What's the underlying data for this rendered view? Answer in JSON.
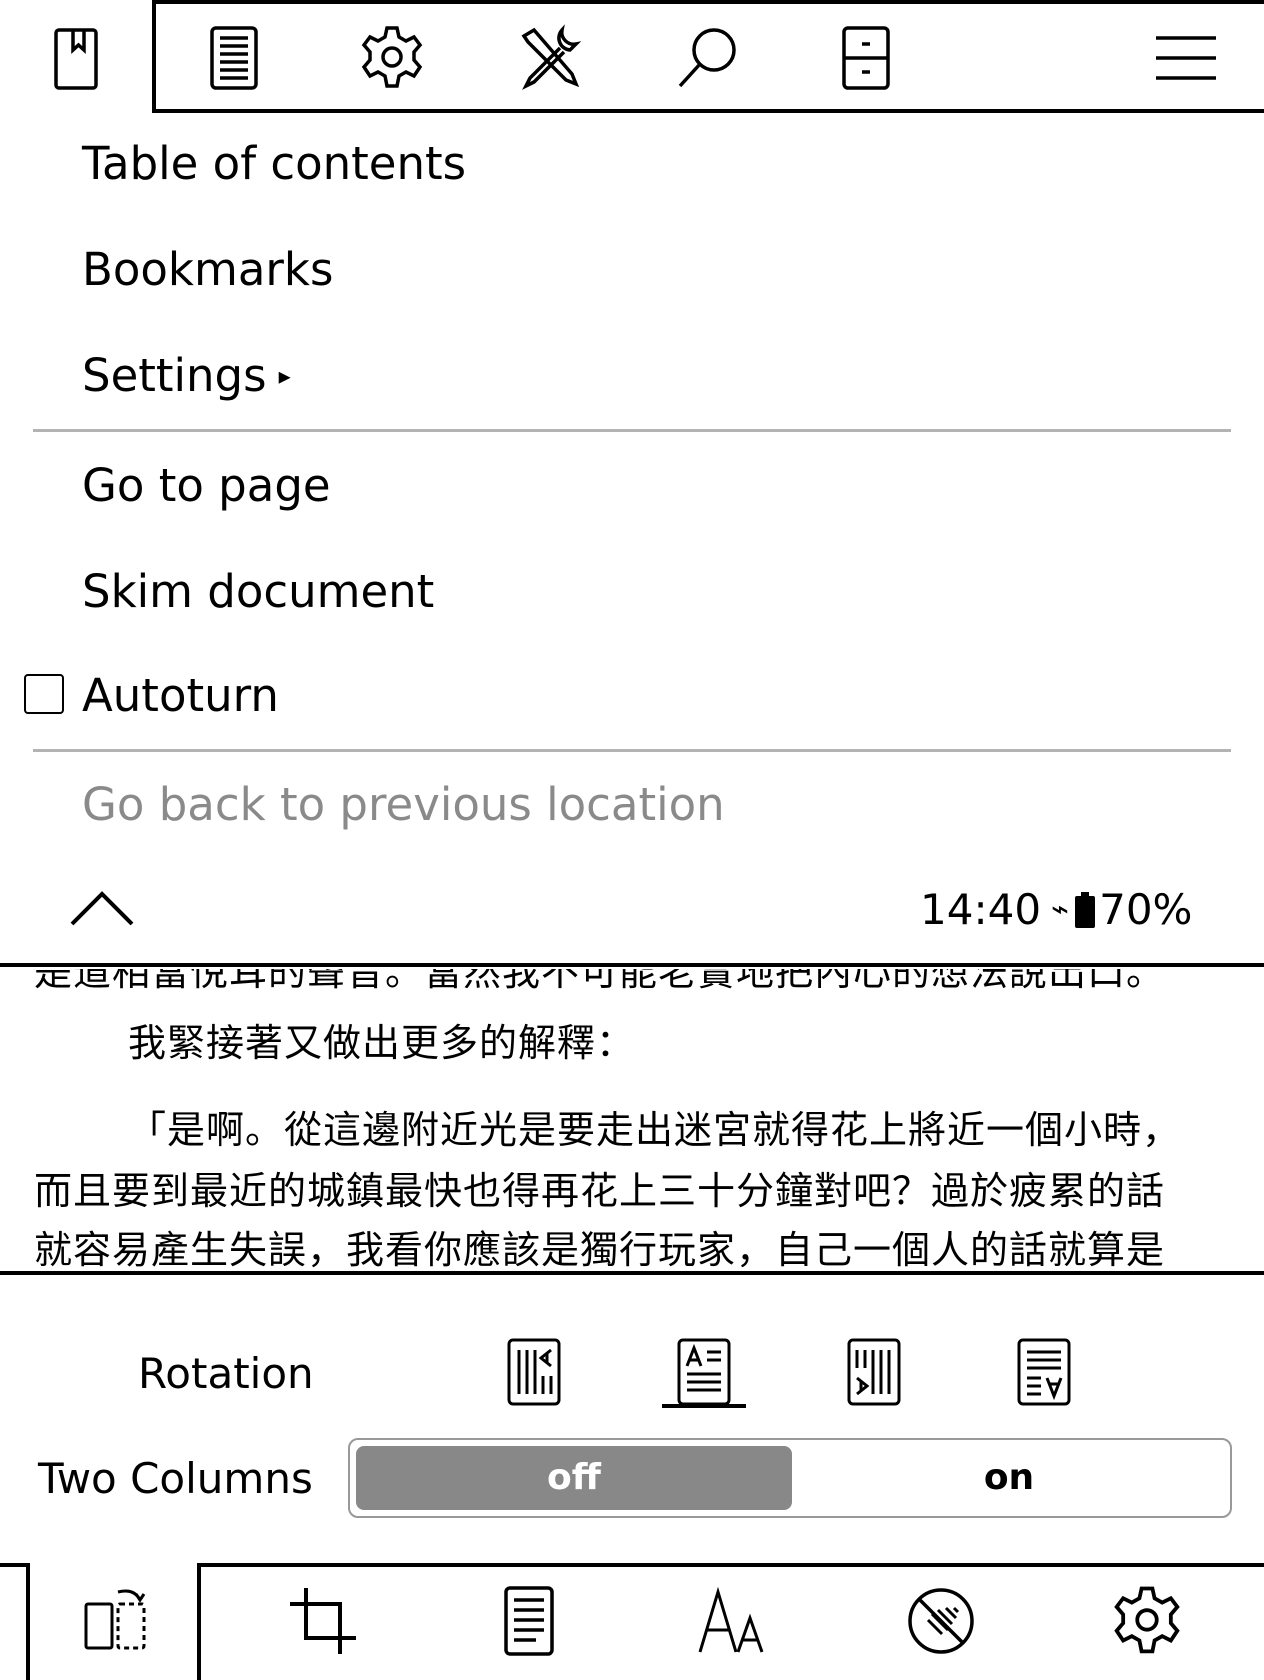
{
  "top_tabs": [
    {
      "icon": "bookmark-book-icon"
    },
    {
      "icon": "document-icon"
    },
    {
      "icon": "gear-icon"
    },
    {
      "icon": "tools-icon"
    },
    {
      "icon": "search-icon"
    },
    {
      "icon": "page-navigation-icon"
    },
    {
      "icon": "hamburger-menu-icon"
    }
  ],
  "menu": {
    "items": [
      {
        "label": "Table of contents"
      },
      {
        "label": "Bookmarks"
      },
      {
        "label": "Settings",
        "submenu_arrow": "▸"
      },
      {
        "label": "Go to page"
      },
      {
        "label": "Skim document"
      },
      {
        "label": "Autoturn",
        "checked": false
      },
      {
        "label": "Go back to previous location",
        "enabled": false
      }
    ],
    "collapse_icon": "chevron-up-icon"
  },
  "status": {
    "time": "14:40",
    "charging_symbol": "⌁",
    "battery": "70%"
  },
  "content": {
    "lines": [
      "是道相當悅耳的聲音。當然我不可能老實地把內心的想法說出口。",
      "我緊接著又做出更多的解釋：",
      "「是啊。從這邊附近光是要走出迷宮就得花上將近一個小時，",
      "而且要到最近的城鎮最快也得再花上三十分鐘對吧？過於疲累的話",
      "就容易產生失誤，我看你應該是獨行玩家，自己一個人的話就算是"
    ]
  },
  "settings": {
    "rotation_label": "Rotation",
    "rotation_options": [
      {
        "icon": "rotate-90-icon"
      },
      {
        "icon": "rotate-0-icon",
        "selected": true
      },
      {
        "icon": "rotate-270-icon"
      },
      {
        "icon": "rotate-180-icon"
      }
    ],
    "two_columns_label": "Two Columns",
    "two_columns_off": "off",
    "two_columns_on": "on",
    "two_columns_value": "off"
  },
  "bottom_tabs": [
    {
      "icon": "page-rotate-icon"
    },
    {
      "icon": "crop-icon"
    },
    {
      "icon": "document-icon"
    },
    {
      "icon": "font-size-icon"
    },
    {
      "icon": "contrast-icon"
    },
    {
      "icon": "gear-icon"
    }
  ]
}
